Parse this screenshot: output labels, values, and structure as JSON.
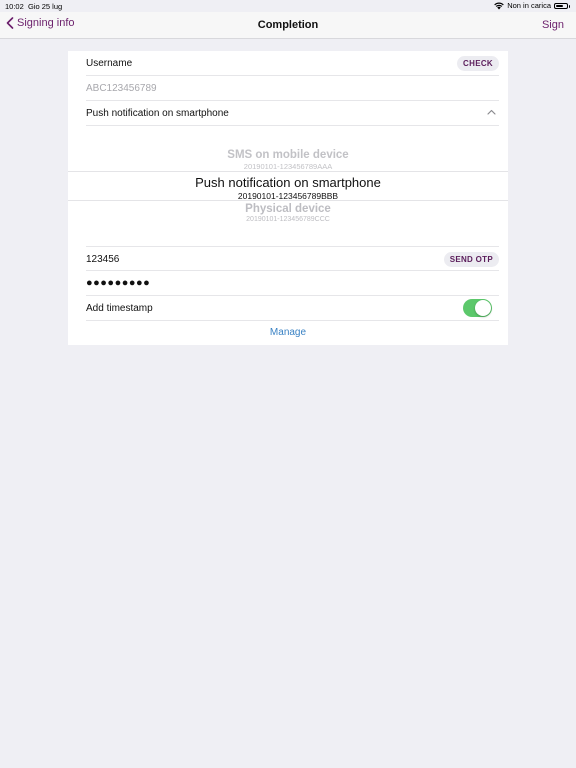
{
  "status_bar": {
    "time": "10:02",
    "date": "Gio 25 lug",
    "charging": "Non in carica"
  },
  "nav": {
    "back_label": "Signing info",
    "title": "Completion",
    "action_label": "Sign"
  },
  "form": {
    "username_label": "Username",
    "check_label": "CHECK",
    "username_value": "ABC123456789",
    "method_label": "Push notification on smartphone",
    "picker": [
      {
        "title": "SMS on mobile device",
        "subtitle": "20190101-123456789AAA"
      },
      {
        "title": "Push notification on smartphone",
        "subtitle": "20190101-123456789BBB"
      },
      {
        "title": "Physical device",
        "subtitle": "20190101-123456789CCC"
      }
    ],
    "otp_value": "123456",
    "send_otp_label": "SEND OTP",
    "password_value": "●●●●●●●●●",
    "timestamp_label": "Add timestamp",
    "timestamp_on": true,
    "manage_label": "Manage"
  },
  "colors": {
    "accent": "#6b1f6b",
    "toggle_on": "#5cc86b",
    "link": "#3a82c4",
    "background": "#efeff4"
  }
}
